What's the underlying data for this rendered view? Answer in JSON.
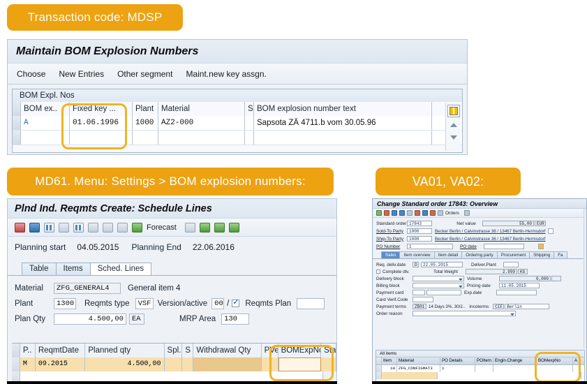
{
  "callouts": {
    "mdsp": "Transaction code: MDSP",
    "md61": "MD61. Menu: Settings > BOM explosion numbers:",
    "va01": "VA01, VA02:"
  },
  "mdsp_window": {
    "title": "Maintain BOM Explosion Numbers",
    "menu": [
      "Choose",
      "New Entries",
      "Other segment",
      "Maint.new key assgn."
    ],
    "subwindow_title": "BOM Expl. Nos",
    "columns": [
      "BOM ex..",
      "Fixed key ...",
      "Plant",
      "Material",
      "S",
      "BOM explosion number text"
    ],
    "rows": [
      {
        "bom_ex": "A",
        "fixed_key": "01.06.1996",
        "plant": "1000",
        "material": "AZ2-000",
        "s": "",
        "text": "Sapsota ZÄ 4711.b vom 30.05.96"
      },
      {
        "bom_ex": "",
        "fixed_key": "",
        "plant": "",
        "material": "",
        "s": "",
        "text": ""
      }
    ],
    "config_icon": "table-settings-icon",
    "scroll_up_icon": "arrow-up-icon",
    "scroll_down_icon": "arrow-down-icon"
  },
  "md61_window": {
    "title": "Plnd Ind. Reqmts Create: Schedule Lines",
    "toolbar": {
      "forecast_label": "Forecast",
      "icons": [
        "print-icon",
        "info-icon",
        "sort-icon",
        "delete-icon",
        "grid-icon",
        "edit-icon",
        "hierarchy-icon",
        "calculator-icon",
        "forecast-icon",
        "select-icon",
        "detail-icon",
        "list-icon",
        "export-icon"
      ]
    },
    "planning": {
      "start_label": "Planning start",
      "start_value": "04.05.2015",
      "end_label": "Planning End",
      "end_value": "22.06.2016"
    },
    "tabs": [
      {
        "label": "Table",
        "active": false
      },
      {
        "label": "Items",
        "active": false
      },
      {
        "label": "Sched. Lines",
        "active": true
      }
    ],
    "form": {
      "material_label": "Material",
      "material_value": "ZFG_GENERAL4",
      "material_desc": "General item 4",
      "plant_label": "Plant",
      "plant_value": "1300",
      "reqmts_type_label": "Reqmts type",
      "reqmts_type_value": "VSF",
      "version_label": "Version/active",
      "version_value": "00",
      "version_sep": "/",
      "version_active": true,
      "reqmts_plan_label": "Reqmts Plan",
      "reqmts_plan_value": "",
      "plan_qty_label": "Plan Qty",
      "plan_qty_value": "4.500,00",
      "plan_qty_uom": "EA",
      "mrp_area_label": "MRP Area",
      "mrp_area_value": "130"
    },
    "grid": {
      "columns": [
        "P..",
        "ReqmtDate",
        "Planned qty",
        "Spl.",
        "S",
        "Withdrawal Qty",
        "PVer",
        "BOMExpNo",
        "Sta"
      ],
      "rows": [
        {
          "p": "M",
          "reqmt_date": "09.2015",
          "planned_qty": "4.500,00",
          "spl": "",
          "s": "",
          "withdrawal_qty": "",
          "pver": "",
          "bom_exp_no": "",
          "sta": ""
        }
      ],
      "bom_help_icon": "search-help-icon"
    }
  },
  "va02_window": {
    "title": "Change Standard order 17843: Overview",
    "toolbar": {
      "orders_label": "Orders",
      "icons": [
        "save-icon",
        "back-icon",
        "exit-icon",
        "cancel-icon",
        "print-icon",
        "find-icon",
        "first-page-icon",
        "last-page-icon",
        "orders-icon",
        "layout-icon"
      ]
    },
    "header": {
      "standard_order_label": "Standard order",
      "standard_order_value": "17843",
      "net_value_label": "Net value",
      "net_value_amount": "55,00",
      "net_value_currency": "EUR",
      "sold_to_label": "Sold-To Party",
      "sold_to_value": "1000",
      "sold_to_desc": "Becker Berlin / Calvinstrasse 36 / 13467 Berlin-Hermsdorf",
      "ship_to_label": "Ship-To Party",
      "ship_to_value": "1000",
      "ship_to_desc": "Becker Berlin / Calvinstrasse 36 / 13467 Berlin-Hermsdorf",
      "po_number_label": "PO Number",
      "po_number_value": "1",
      "po_date_label": "PO date",
      "po_date_value": ""
    },
    "tabs": [
      {
        "label": "Sales",
        "active": true
      },
      {
        "label": "Item overview",
        "active": false
      },
      {
        "label": "Item detail",
        "active": false
      },
      {
        "label": "Ordering party",
        "active": false
      },
      {
        "label": "Procurement",
        "active": false
      },
      {
        "label": "Shipping",
        "active": false
      },
      {
        "label": "Fa",
        "active": false
      }
    ],
    "form": {
      "req_deliv_date_label": "Req. deliv.date",
      "req_deliv_date_type": "D",
      "req_deliv_date_value": "22.05.2015",
      "deliver_plant_label": "Deliver.Plant",
      "deliver_plant_value": "",
      "complete_dlv_label": "Complete dlv.",
      "total_weight_label": "Total Weight",
      "total_weight_value": "2.999",
      "total_weight_uom": "KG",
      "delivery_block_label": "Delivery block",
      "delivery_block_value": "",
      "volume_label": "Volume",
      "volume_value": "0,000",
      "billing_block_label": "Billing block",
      "billing_block_value": "",
      "pricing_date_label": "Pricing date",
      "pricing_date_value": "11.05.2015",
      "payment_card_label": "Payment card",
      "payment_card_value": "",
      "exp_date_label": "Exp.date",
      "exp_date_value": "",
      "card_verif_label": "Card Verif.Code",
      "card_verif_value": "",
      "payment_terms_label": "Payment terms",
      "payment_terms_code": "ZB01",
      "payment_terms_desc": "14 Days 3%, 30/2..",
      "incoterms_label": "Incoterms",
      "incoterms_code": "CIF",
      "incoterms_city": "Berlin",
      "order_reason_label": "Order reason",
      "order_reason_value": ""
    },
    "items": {
      "title": "All items",
      "columns": [
        "Item",
        "Material",
        "PO Details",
        "POItem",
        "Engin.Change",
        "BOMexpNo",
        "A"
      ],
      "rows": [
        {
          "item": "10",
          "material": "ZFG_CONFIGMAT3",
          "po_details": "1",
          "po_item": "",
          "engin_change": "",
          "bom_exp_no": "",
          "a": ""
        }
      ]
    }
  }
}
